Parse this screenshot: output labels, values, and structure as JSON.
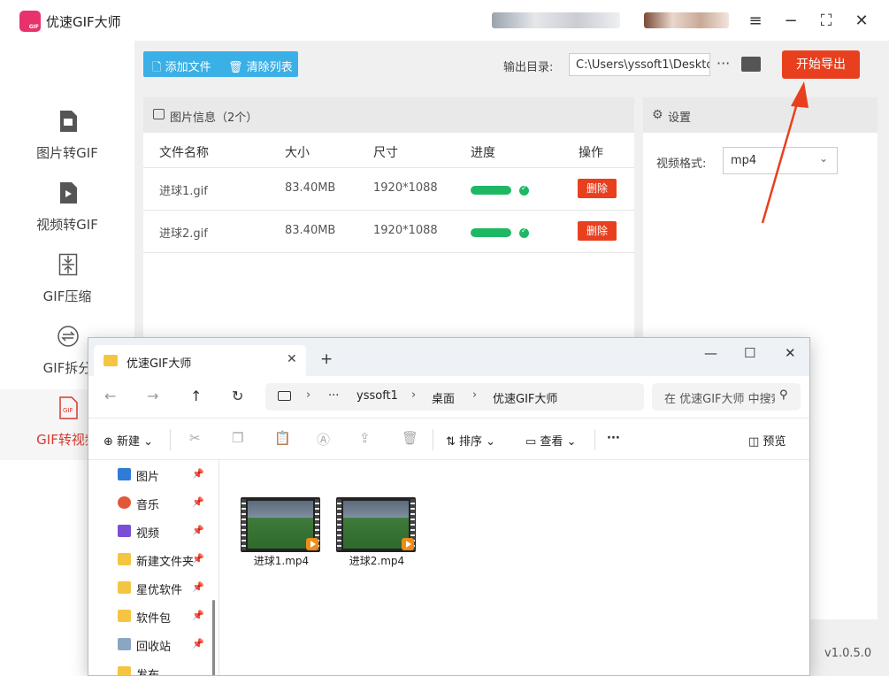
{
  "app": {
    "title": "优速GIF大师",
    "version": "v1.0.5.0",
    "version_colon": ":"
  },
  "sidebar": {
    "items": [
      {
        "label": "图片转GIF"
      },
      {
        "label": "视频转GIF"
      },
      {
        "label": "GIF压缩"
      },
      {
        "label": "GIF拆分"
      },
      {
        "label": "GIF转视频"
      }
    ]
  },
  "toolbar": {
    "add_label": "添加文件",
    "clear_label": "清除列表",
    "output_label": "输出目录:",
    "output_path": "C:\\Users\\yssoft1\\Deskto",
    "more": "···",
    "start_label": "开始导出"
  },
  "file_panel": {
    "title": "图片信息（2个）",
    "headers": [
      "文件名称",
      "大小",
      "尺寸",
      "进度",
      "操作"
    ],
    "rows": [
      {
        "name": "进球1.gif",
        "size": "83.40MB",
        "dims": "1920*1088",
        "progress": 1.0,
        "action": "删除"
      },
      {
        "name": "进球2.gif",
        "size": "83.40MB",
        "dims": "1920*1088",
        "progress": 1.0,
        "action": "删除"
      }
    ]
  },
  "settings": {
    "title": "设置",
    "format_label": "视频格式:",
    "format_value": "mp4"
  },
  "explorer": {
    "tab_title": "优速GIF大师",
    "breadcrumb": [
      "···",
      "yssoft1",
      "桌面",
      "优速GIF大师"
    ],
    "search_placeholder": "在 优速GIF大师 中搜索",
    "commands": {
      "new": "新建",
      "sort": "排序",
      "view": "查看",
      "more": "···",
      "preview": "预览"
    },
    "nav_items": [
      {
        "label": "图片",
        "icon": "pictures-icon",
        "color": "#2f7bd6"
      },
      {
        "label": "音乐",
        "icon": "music-icon",
        "color": "#e0573c"
      },
      {
        "label": "视频",
        "icon": "videos-icon",
        "color": "#7a4fd3"
      },
      {
        "label": "新建文件夹",
        "icon": "folder-icon",
        "color": "#f5c542"
      },
      {
        "label": "星优软件",
        "icon": "folder-icon",
        "color": "#f5c542"
      },
      {
        "label": "软件包",
        "icon": "folder-icon",
        "color": "#f5c542"
      },
      {
        "label": "回收站",
        "icon": "recycle-bin-icon",
        "color": "#8aa6c2"
      },
      {
        "label": "发布",
        "icon": "folder-icon",
        "color": "#f5c542"
      }
    ],
    "files": [
      {
        "name": "进球1.mp4"
      },
      {
        "name": "进球2.mp4"
      }
    ]
  },
  "colors": {
    "accent_red": "#e8401f",
    "accent_blue": "#3ab0e7",
    "progress_green": "#1eb864",
    "active_sidebar_text": "#d9392f"
  }
}
